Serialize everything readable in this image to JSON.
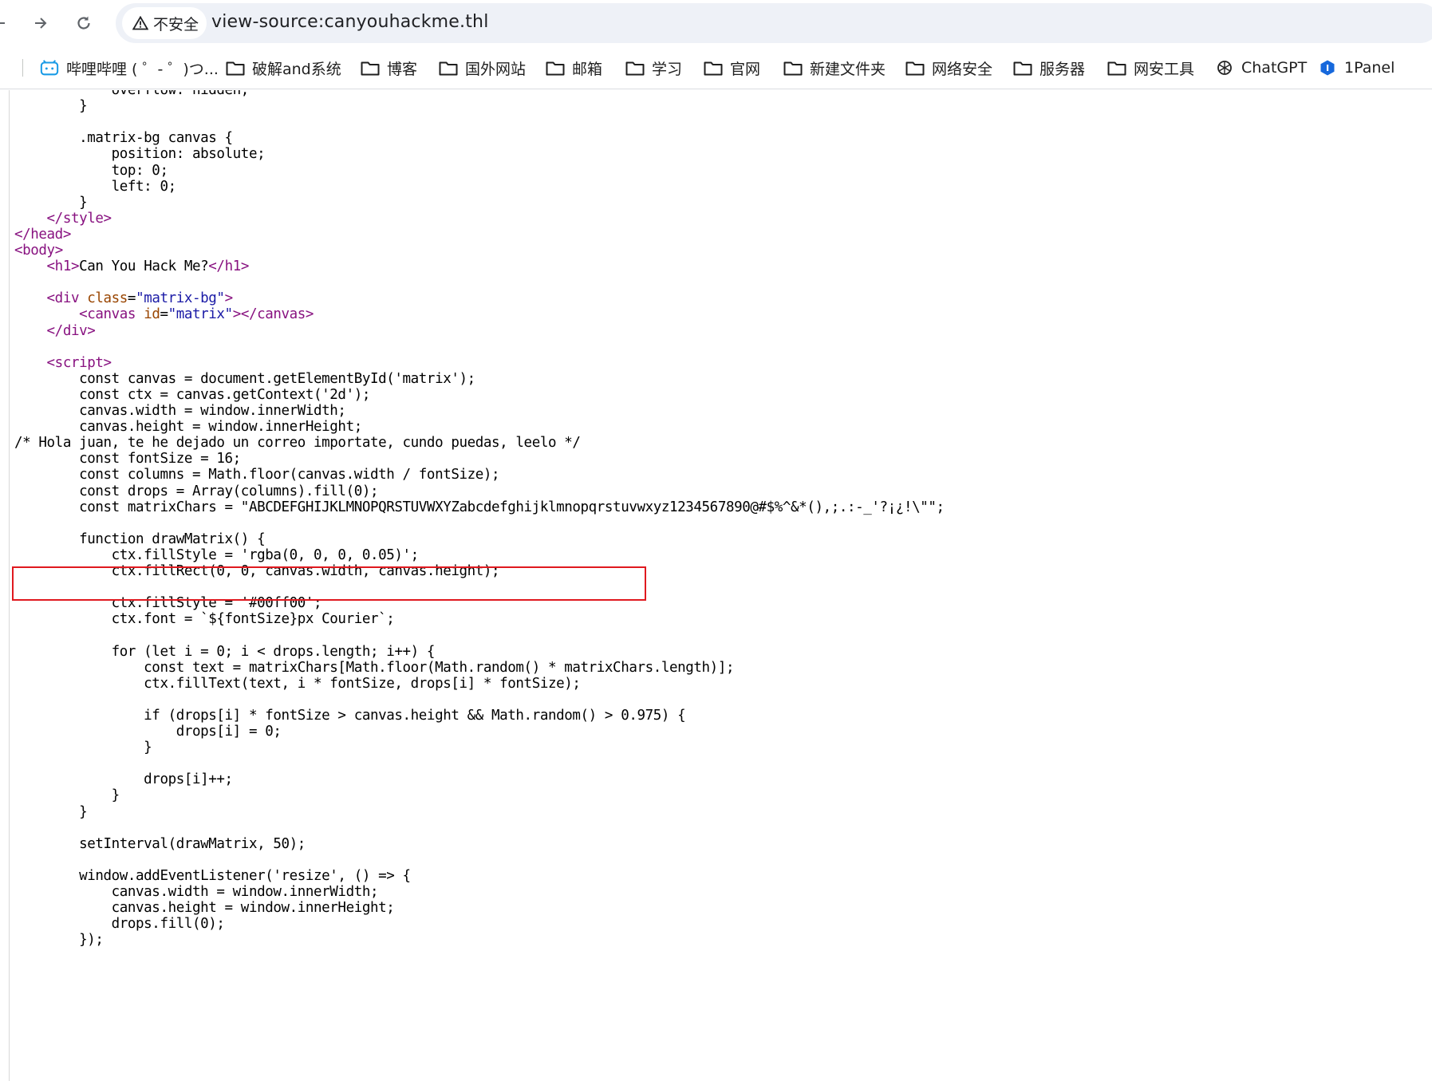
{
  "toolbar": {
    "back_icon": "arrow-left-icon",
    "forward_icon": "arrow-right-icon",
    "reload_icon": "reload-icon",
    "security_icon": "warning-triangle-icon",
    "security_label": "不安全",
    "url": "view-source:canyouhackme.thl"
  },
  "bookmarks": [
    {
      "icon": "bilibili-icon",
      "label": "哔哩哔哩 ( ゜- ゜)つ..."
    },
    {
      "icon": "folder-icon",
      "label": "破解and系统"
    },
    {
      "icon": "folder-icon",
      "label": "博客"
    },
    {
      "icon": "folder-icon",
      "label": "国外网站"
    },
    {
      "icon": "folder-icon",
      "label": "邮箱"
    },
    {
      "icon": "folder-icon",
      "label": "学习"
    },
    {
      "icon": "folder-icon",
      "label": "官网"
    },
    {
      "icon": "folder-icon",
      "label": "新建文件夹"
    },
    {
      "icon": "folder-icon",
      "label": "网络安全"
    },
    {
      "icon": "folder-icon",
      "label": "服务器"
    },
    {
      "icon": "folder-icon",
      "label": "网安工具"
    },
    {
      "icon": "chatgpt-icon",
      "label": "ChatGPT"
    },
    {
      "icon": "1panel-icon",
      "label": "1Panel"
    }
  ],
  "source": {
    "highlight_color": "#e0191f",
    "lines": [
      "            overflow: hidden;",
      "        }",
      "",
      "        .matrix-bg canvas {",
      "            position: absolute;",
      "            top: 0;",
      "            left: 0;",
      "        }",
      "    </style>",
      "</head>",
      "<body>",
      "    <h1>Can You Hack Me?</h1>",
      "",
      "    <div class=\"matrix-bg\">",
      "        <canvas id=\"matrix\"></canvas>",
      "    </div>",
      "",
      "    <script>",
      "        const canvas = document.getElementById('matrix');",
      "        const ctx = canvas.getContext('2d');",
      "        canvas.width = window.innerWidth;",
      "        canvas.height = window.innerHeight;",
      "/* Hola juan, te he dejado un correo importate, cundo puedas, leelo */",
      "        const fontSize = 16;",
      "        const columns = Math.floor(canvas.width / fontSize);",
      "        const drops = Array(columns).fill(0);",
      "        const matrixChars = \"ABCDEFGHIJKLMNOPQRSTUVWXYZabcdefghijklmnopqrstuvwxyz1234567890@#$%^&*(),;.:-_'?¡¿!\\\"\";",
      "",
      "        function drawMatrix() {",
      "            ctx.fillStyle = 'rgba(0, 0, 0, 0.05)';",
      "            ctx.fillRect(0, 0, canvas.width, canvas.height);",
      "",
      "            ctx.fillStyle = '#00ff00';",
      "            ctx.font = `${fontSize}px Courier`;",
      "",
      "            for (let i = 0; i < drops.length; i++) {",
      "                const text = matrixChars[Math.floor(Math.random() * matrixChars.length)];",
      "                ctx.fillText(text, i * fontSize, drops[i] * fontSize);",
      "",
      "                if (drops[i] * fontSize > canvas.height && Math.random() > 0.975) {",
      "                    drops[i] = 0;",
      "                }",
      "",
      "                drops[i]++;",
      "            }",
      "        }",
      "",
      "        setInterval(drawMatrix, 50);",
      "",
      "        window.addEventListener('resize', () => {",
      "            canvas.width = window.innerWidth;",
      "            canvas.height = window.innerHeight;",
      "            drops.fill(0);",
      "        });"
    ]
  }
}
